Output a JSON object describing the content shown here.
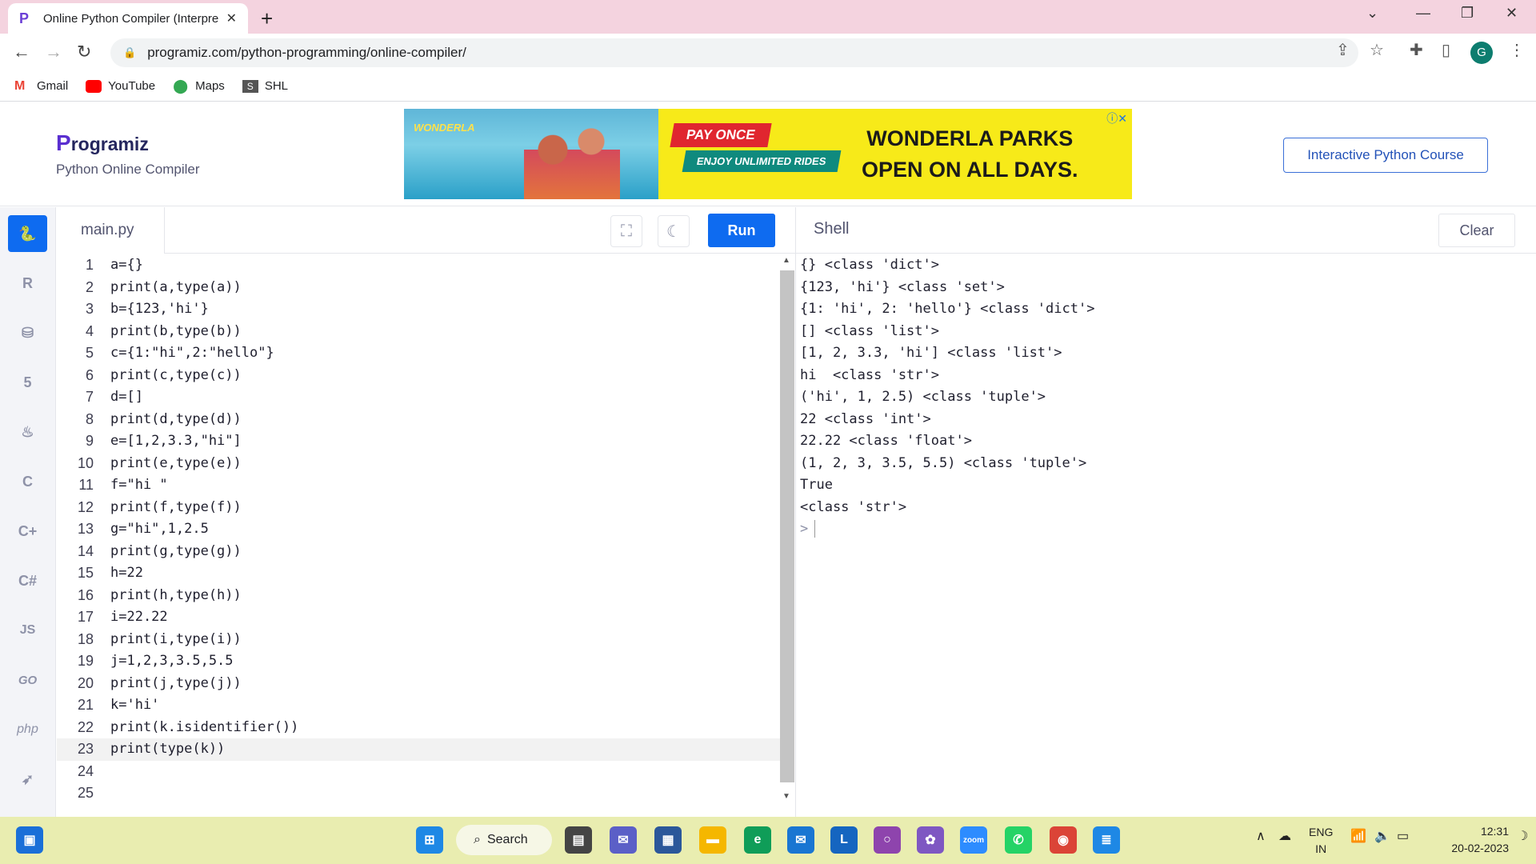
{
  "browser": {
    "tab_title": "Online Python Compiler (Interpre",
    "url": "programiz.com/python-programming/online-compiler/",
    "profile_initial": "G",
    "bookmarks": [
      "Gmail",
      "YouTube",
      "Maps",
      "SHL"
    ]
  },
  "site": {
    "logo_text": "rogramiz",
    "logo_mark": "P",
    "subtitle": "Python Online Compiler",
    "course_button": "Interactive Python Course"
  },
  "ad": {
    "brand": "WONDERLA",
    "pay_once": "PAY ONCE",
    "enjoy": "ENJOY UNLIMITED RIDES",
    "headline_1": "WONDERLA PARKS",
    "headline_2": "OPEN ON ALL DAYS."
  },
  "sidebar": {
    "languages": [
      "python",
      "r",
      "sql",
      "html",
      "java",
      "c",
      "cpp",
      "csharp",
      "JS",
      "GO",
      "php",
      "swift"
    ]
  },
  "editor": {
    "filename": "main.py",
    "run_label": "Run",
    "active_line": 23,
    "lines": [
      "a={}",
      "print(a,type(a))",
      "b={123,'hi'}",
      "print(b,type(b))",
      "c={1:\"hi\",2:\"hello\"}",
      "print(c,type(c))",
      "d=[]",
      "print(d,type(d))",
      "e=[1,2,3.3,\"hi\"]",
      "print(e,type(e))",
      "f=\"hi \"",
      "print(f,type(f))",
      "g=\"hi\",1,2.5",
      "print(g,type(g))",
      "h=22",
      "print(h,type(h))",
      "i=22.22",
      "print(i,type(i))",
      "j=1,2,3,3.5,5.5",
      "print(j,type(j))",
      "k='hi'",
      "print(k.isidentifier())",
      "print(type(k))",
      "",
      ""
    ]
  },
  "shell": {
    "title": "Shell",
    "clear_label": "Clear",
    "prompt": ">",
    "output": [
      "{} <class 'dict'>",
      "{123, 'hi'} <class 'set'>",
      "{1: 'hi', 2: 'hello'} <class 'dict'>",
      "[] <class 'list'>",
      "[1, 2, 3.3, 'hi'] <class 'list'>",
      "hi  <class 'str'>",
      "('hi', 1, 2.5) <class 'tuple'>",
      "22 <class 'int'>",
      "22.22 <class 'float'>",
      "(1, 2, 3, 3.5, 5.5) <class 'tuple'>",
      "True",
      "<class 'str'>"
    ]
  },
  "taskbar": {
    "search_label": "Search",
    "lang_line1": "ENG",
    "lang_line2": "IN",
    "time": "12:31",
    "date": "20-02-2023"
  }
}
